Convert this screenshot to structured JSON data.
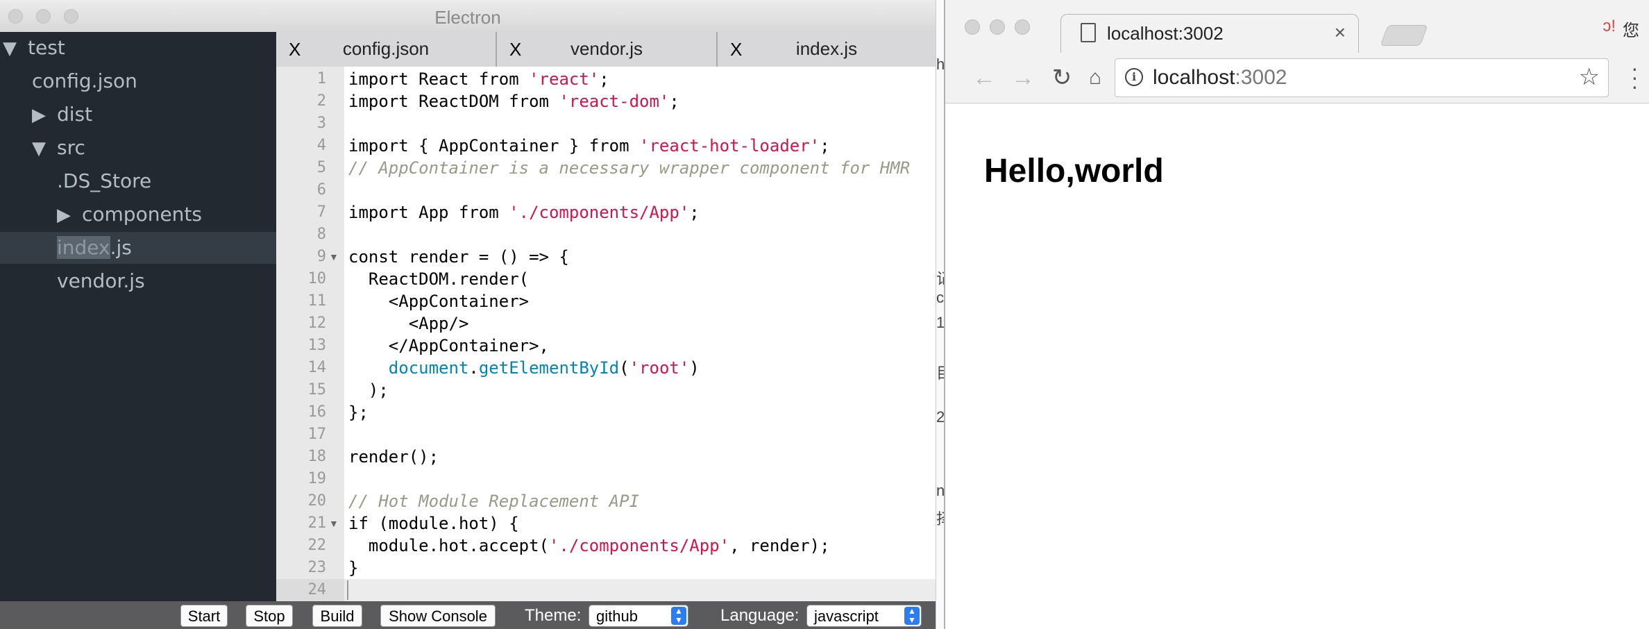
{
  "electron": {
    "title": "Electron",
    "tree": [
      {
        "label": "test",
        "caret": "▼",
        "depth": 0
      },
      {
        "label": "config.json",
        "caret": "",
        "depth": 1
      },
      {
        "label": "dist",
        "caret": "▶",
        "depth": 1
      },
      {
        "label": "src",
        "caret": "▼",
        "depth": 1
      },
      {
        "label": ".DS_Store",
        "caret": "",
        "depth": 2
      },
      {
        "label": "components",
        "caret": "▶",
        "depth": 2
      },
      {
        "label_hl": "index",
        "label_rest": ".js",
        "caret": "",
        "depth": 2,
        "active": true
      },
      {
        "label": "vendor.js",
        "caret": "",
        "depth": 2
      }
    ],
    "tabs": [
      {
        "close": "X",
        "name": "config.json"
      },
      {
        "close": "X",
        "name": "vendor.js"
      },
      {
        "close": "X",
        "name": "index.js"
      }
    ],
    "code": [
      [
        [
          "tx",
          "import React from "
        ],
        [
          "str",
          "'react'"
        ],
        [
          "tx",
          ";"
        ]
      ],
      [
        [
          "tx",
          "import ReactDOM from "
        ],
        [
          "str",
          "'react-dom'"
        ],
        [
          "tx",
          ";"
        ]
      ],
      [],
      [
        [
          "tx",
          "import { AppContainer } from "
        ],
        [
          "str",
          "'react-hot-loader'"
        ],
        [
          "tx",
          ";"
        ]
      ],
      [
        [
          "cmt",
          "// AppContainer is a necessary wrapper component for HMR"
        ]
      ],
      [],
      [
        [
          "tx",
          "import App from "
        ],
        [
          "str",
          "'./components/App'"
        ],
        [
          "tx",
          ";"
        ]
      ],
      [],
      [
        [
          "tx",
          "const render = () => {"
        ]
      ],
      [
        [
          "tx",
          "  ReactDOM.render("
        ]
      ],
      [
        [
          "tx",
          "    <AppContainer>"
        ]
      ],
      [
        [
          "tx",
          "      <App/>"
        ]
      ],
      [
        [
          "tx",
          "    </AppContainer>,"
        ]
      ],
      [
        [
          "tx",
          "    "
        ],
        [
          "bi",
          "document"
        ],
        [
          "tx",
          "."
        ],
        [
          "bi",
          "getElementById"
        ],
        [
          "tx",
          "("
        ],
        [
          "str",
          "'root'"
        ],
        [
          "tx",
          ")"
        ]
      ],
      [
        [
          "tx",
          "  );"
        ]
      ],
      [
        [
          "tx",
          "};"
        ]
      ],
      [],
      [
        [
          "tx",
          "render();"
        ]
      ],
      [],
      [
        [
          "cmt",
          "// Hot Module Replacement API"
        ]
      ],
      [
        [
          "tx",
          "if (module.hot) {"
        ]
      ],
      [
        [
          "tx",
          "  module.hot.accept("
        ],
        [
          "str",
          "'./components/App'"
        ],
        [
          "tx",
          ", render);"
        ]
      ],
      [
        [
          "tx",
          "}"
        ]
      ],
      []
    ],
    "fold_lines": [
      9,
      21
    ],
    "active_line": 24,
    "bottom": {
      "start": "Start",
      "stop": "Stop",
      "build": "Build",
      "show_console": "Show Console",
      "theme_label": "Theme:",
      "theme_value": "github",
      "language_label": "Language:",
      "language_value": "javascript"
    },
    "behind_glyphs": [
      "hu",
      "记c",
      "1",
      "目",
      "2",
      "nt",
      "择"
    ]
  },
  "chrome": {
    "tab_title": "localhost:3002",
    "tab_close": "×",
    "url_host": "localhost",
    "url_port": ":3002",
    "ext_icon": "ↄ!",
    "ext_text": "您",
    "page_heading": "Hello,world"
  }
}
